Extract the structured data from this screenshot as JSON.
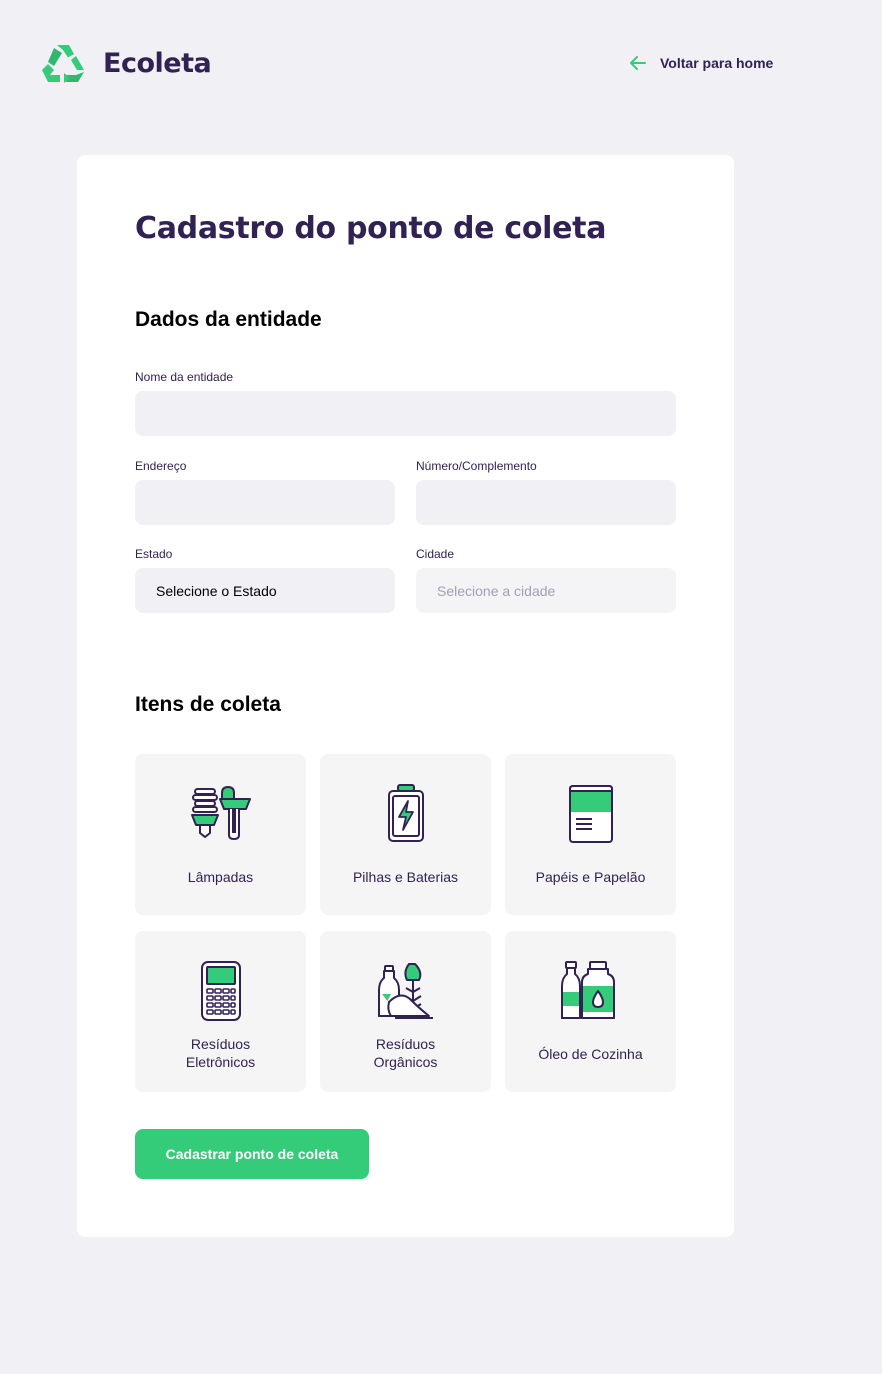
{
  "header": {
    "logo_text": "Ecoleta",
    "logo_icon": "recycle-icon",
    "back_label": "Voltar para home",
    "back_icon": "arrow-left-icon"
  },
  "form": {
    "title": "Cadastro do ponto de coleta",
    "entity_section_title": "Dados da entidade",
    "fields": {
      "name": {
        "label": "Nome da entidade",
        "value": ""
      },
      "address": {
        "label": "Endereço",
        "value": ""
      },
      "number": {
        "label": "Número/Complemento",
        "value": ""
      },
      "state": {
        "label": "Estado",
        "selected": "Selecione o Estado"
      },
      "city": {
        "label": "Cidade",
        "selected": "Selecione a cidade"
      }
    },
    "items_section_title": "Itens de coleta",
    "items": [
      {
        "label": "Lâmpadas",
        "icon": "lamps-icon"
      },
      {
        "label": "Pilhas e Baterias",
        "icon": "battery-icon"
      },
      {
        "label": "Papéis e Papelão",
        "icon": "paper-icon"
      },
      {
        "label_lines": [
          "Resíduos",
          "Eletrônicos"
        ],
        "icon": "electronics-icon"
      },
      {
        "label_lines": [
          "Resíduos",
          "Orgânicos"
        ],
        "icon": "organic-icon"
      },
      {
        "label": "Óleo de Cozinha",
        "icon": "oil-icon"
      }
    ],
    "submit_label": "Cadastrar ponto de coleta"
  },
  "colors": {
    "primary": "#34CB79",
    "title": "#322153",
    "background": "#F0F0F5",
    "card": "#FFFFFF",
    "item_bg": "#F5F5F5"
  }
}
